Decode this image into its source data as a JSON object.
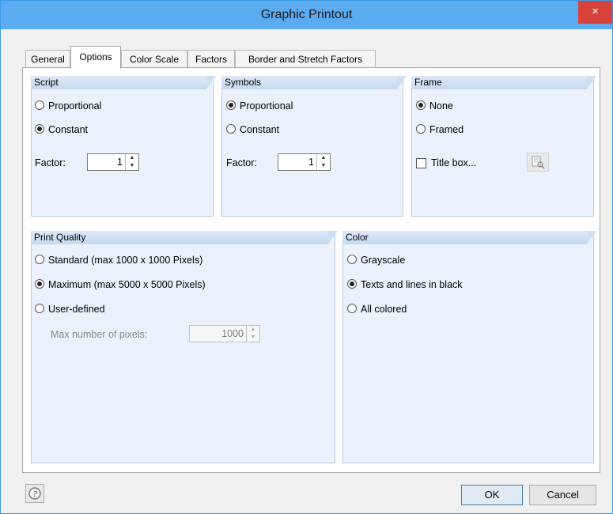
{
  "window": {
    "title": "Graphic Printout",
    "close_glyph": "×"
  },
  "tabs": [
    {
      "label": "General",
      "active": false
    },
    {
      "label": "Options",
      "active": true
    },
    {
      "label": "Color Scale",
      "active": false
    },
    {
      "label": "Factors",
      "active": false
    },
    {
      "label": "Border and Stretch Factors",
      "active": false
    }
  ],
  "script": {
    "header": "Script",
    "options": [
      {
        "label": "Proportional",
        "selected": false
      },
      {
        "label": "Constant",
        "selected": true
      }
    ],
    "factor_label": "Factor:",
    "factor_value": "1"
  },
  "symbols": {
    "header": "Symbols",
    "options": [
      {
        "label": "Proportional",
        "selected": true
      },
      {
        "label": "Constant",
        "selected": false
      }
    ],
    "factor_label": "Factor:",
    "factor_value": "1"
  },
  "frame": {
    "header": "Frame",
    "options": [
      {
        "label": "None",
        "selected": true
      },
      {
        "label": "Framed",
        "selected": false
      }
    ],
    "title_box_label": "Title box...",
    "title_box_checked": false,
    "edit_icon": "edit-title-box-icon"
  },
  "print_quality": {
    "header": "Print Quality",
    "options": [
      {
        "label": "Standard (max 1000 x 1000 Pixels)",
        "selected": false
      },
      {
        "label": "Maximum (max 5000 x 5000 Pixels)",
        "selected": true
      },
      {
        "label": "User-defined",
        "selected": false
      }
    ],
    "max_pixels_label": "Max number of pixels:",
    "max_pixels_value": "1000"
  },
  "color": {
    "header": "Color",
    "options": [
      {
        "label": "Grayscale",
        "selected": false
      },
      {
        "label": "Texts and lines in black",
        "selected": true
      },
      {
        "label": "All colored",
        "selected": false
      }
    ]
  },
  "footer": {
    "ok_label": "OK",
    "cancel_label": "Cancel",
    "help_icon": "help-icon"
  },
  "colors": {
    "titlebar": "#5aabef",
    "close": "#d9423a",
    "group_bg": "#eaf1fb",
    "group_header": "#c6d8ef"
  }
}
